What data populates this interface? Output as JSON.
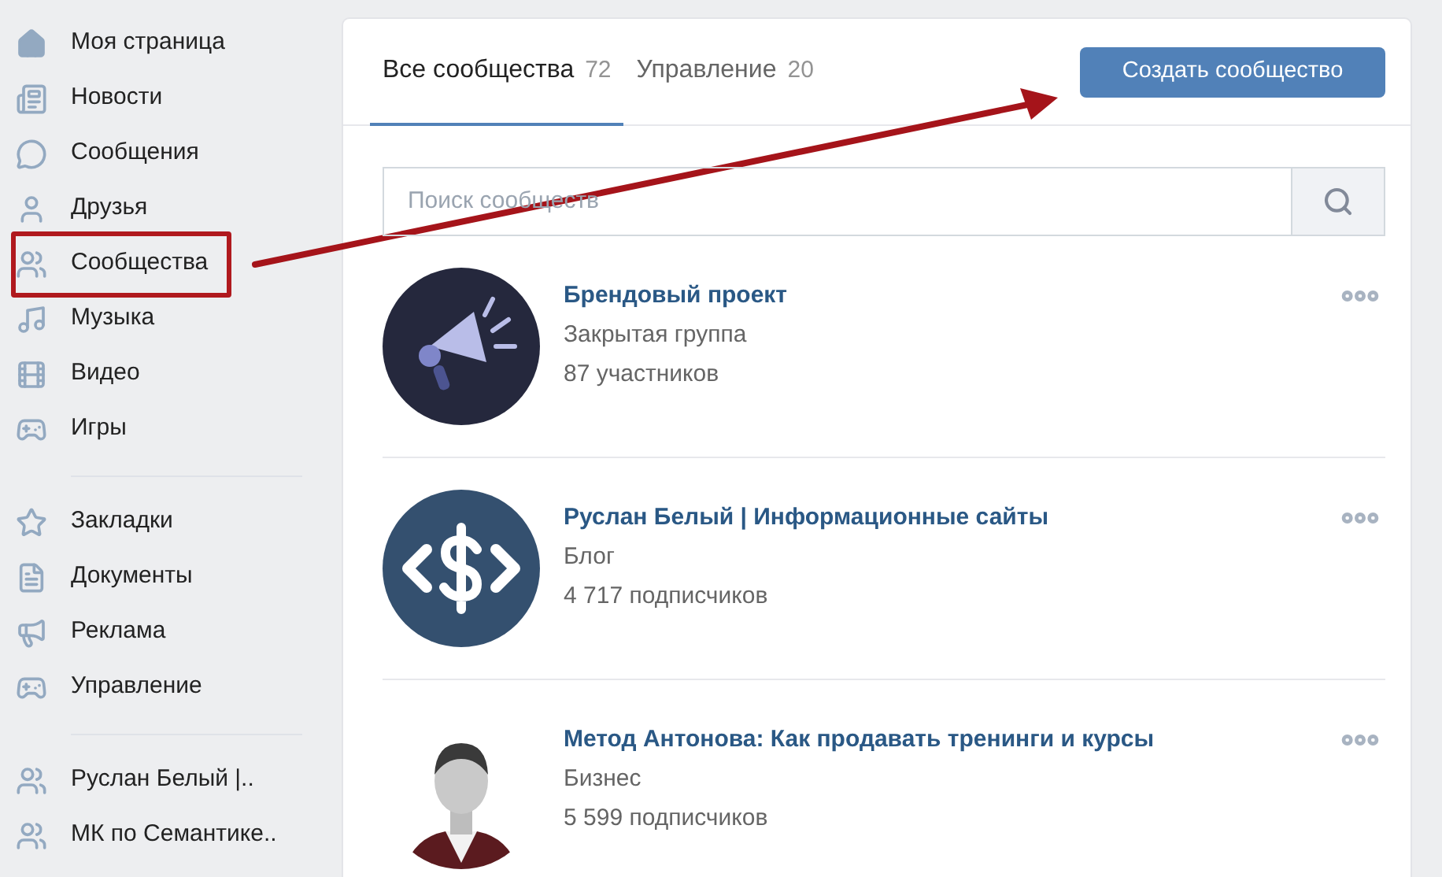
{
  "sidebar": {
    "sections": [
      {
        "items": [
          {
            "label": "Моя страница",
            "annotated": false
          },
          {
            "label": "Новости",
            "annotated": false
          },
          {
            "label": "Сообщения",
            "annotated": false
          },
          {
            "label": "Друзья",
            "annotated": false
          },
          {
            "label": "Сообщества",
            "annotated": true
          },
          {
            "label": "Музыка",
            "annotated": false
          },
          {
            "label": "Видео",
            "annotated": false
          },
          {
            "label": "Игры",
            "annotated": false
          }
        ]
      },
      {
        "items": [
          {
            "label": "Закладки",
            "annotated": false
          },
          {
            "label": "Документы",
            "annotated": false
          },
          {
            "label": "Реклама",
            "annotated": false
          },
          {
            "label": "Управление",
            "annotated": false
          }
        ]
      },
      {
        "items": [
          {
            "label": "Руслан Белый |..",
            "annotated": false
          },
          {
            "label": "МК по Семантике..",
            "annotated": false
          }
        ]
      }
    ]
  },
  "tabs": [
    {
      "label": "Все сообщества",
      "count": "72",
      "selected": true
    },
    {
      "label": "Управление",
      "count": "20",
      "selected": false
    }
  ],
  "create_button": "Создать сообщество",
  "search": {
    "placeholder": "Поиск сообществ"
  },
  "communities": [
    {
      "name": "Брендовый проект",
      "type": "Закрытая группа",
      "members": "87 участников"
    },
    {
      "name": "Руслан Белый | Информационные сайты",
      "type": "Блог",
      "members": "4 717 подписчиков"
    },
    {
      "name": "Метод Антонова: Как продавать тренинги и курсы",
      "type": "Бизнес",
      "members": "5 599 подписчиков"
    }
  ]
}
